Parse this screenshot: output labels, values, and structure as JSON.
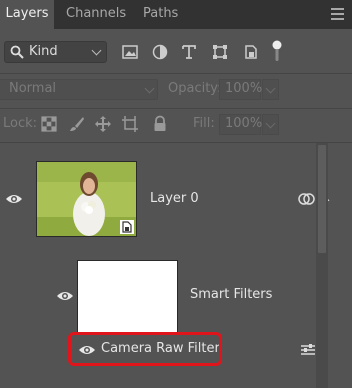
{
  "tabs": [
    {
      "label": "Layers",
      "active": true
    },
    {
      "label": "Channels",
      "active": false
    },
    {
      "label": "Paths",
      "active": false
    }
  ],
  "filter": {
    "kind_label": "Kind",
    "icons": [
      "pixel-layer-filter-icon",
      "adjustment-layer-filter-icon",
      "type-layer-filter-icon",
      "shape-layer-filter-icon",
      "smart-object-filter-icon",
      "filter-toggle-icon"
    ]
  },
  "blend": {
    "mode": "Normal",
    "opacity_label": "Opacity:",
    "opacity_value": "100%"
  },
  "lock": {
    "label": "Lock:",
    "icons": [
      "lock-transparent-pixels-icon",
      "lock-image-pixels-icon",
      "lock-position-icon",
      "lock-artboard-icon",
      "lock-all-icon"
    ],
    "fill_label": "Fill:",
    "fill_value": "100%"
  },
  "layers": [
    {
      "name": "Layer 0",
      "visible": true,
      "type": "smart-object"
    },
    {
      "name": "Smart Filters",
      "visible": true,
      "type": "smart-filter-mask"
    },
    {
      "name": "Camera Raw Filter",
      "visible": true,
      "type": "filter",
      "highlighted": true
    }
  ],
  "colors": {
    "panel_bg": "#535353",
    "tabbar_bg": "#323232",
    "highlight": "#e0141b"
  }
}
